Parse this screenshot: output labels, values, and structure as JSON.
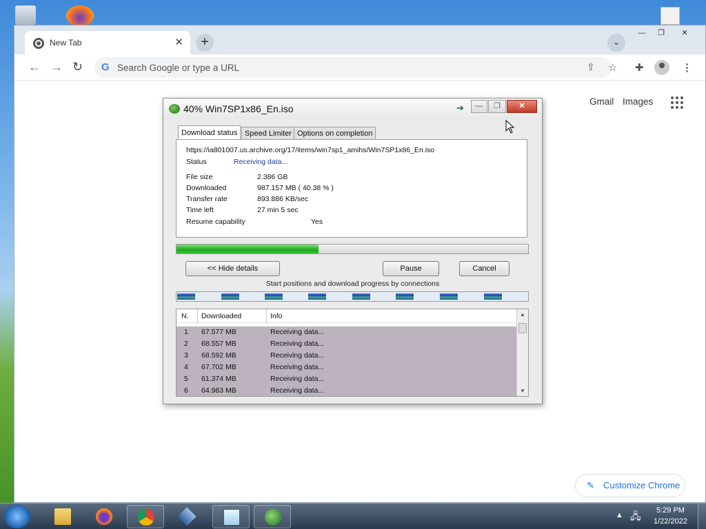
{
  "browser": {
    "tab_title": "New Tab",
    "tab_close": "✕",
    "new_tab": "+",
    "tab_search": "⌄",
    "minimize": "—",
    "maximize": "❐",
    "close": "✕",
    "omnibox_placeholder": "Search Google or type a URL",
    "back": "←",
    "forward": "→",
    "reload": "↻",
    "gmail": "Gmail",
    "images": "Images",
    "customize": "Customize Chrome",
    "customize_icon": "✎"
  },
  "idm": {
    "title": "40% Win7SP1x86_En.iso",
    "tabs": [
      "Download status",
      "Speed Limiter",
      "Options on completion"
    ],
    "url": "https://ia801007.us.archive.org/17/items/win7sp1_amihs/Win7SP1x86_En.iso",
    "status_label": "Status",
    "status_value": "Receiving data...",
    "status_color": "#1a3ea8",
    "fields": [
      {
        "label": "File size",
        "value": "2.386  GB"
      },
      {
        "label": "Downloaded",
        "value": "987.157  MB  ( 40.38 % )"
      },
      {
        "label": "Transfer rate",
        "value": "893.886  KB/sec"
      },
      {
        "label": "Time left",
        "value": "27 min 5 sec"
      }
    ],
    "resume_label": "Resume capability",
    "resume_value": "Yes",
    "progress": 0.4038,
    "hide_details": "<< Hide details",
    "pause": "Pause",
    "cancel": "Cancel",
    "connections_label": "Start positions and download progress by connections",
    "table": {
      "headers": [
        "N.",
        "Downloaded",
        "Info"
      ],
      "rows": [
        {
          "n": "1",
          "downloaded": "67.577  MB",
          "info": "Receiving data..."
        },
        {
          "n": "2",
          "downloaded": "68.557  MB",
          "info": "Receiving data..."
        },
        {
          "n": "3",
          "downloaded": "68.592  MB",
          "info": "Receiving data..."
        },
        {
          "n": "4",
          "downloaded": "67.702  MB",
          "info": "Receiving data..."
        },
        {
          "n": "5",
          "downloaded": "61.374  MB",
          "info": "Receiving data..."
        },
        {
          "n": "6",
          "downloaded": "64.983  MB",
          "info": "Receiving data..."
        }
      ]
    }
  },
  "taskbar": {
    "apps": [
      "windows-explorer-icon",
      "firefox-icon",
      "chrome-icon",
      "virtualbox-icon",
      "notepad-icon",
      "idm-icon"
    ],
    "time": "5:29 PM",
    "date": "1/22/2022"
  }
}
